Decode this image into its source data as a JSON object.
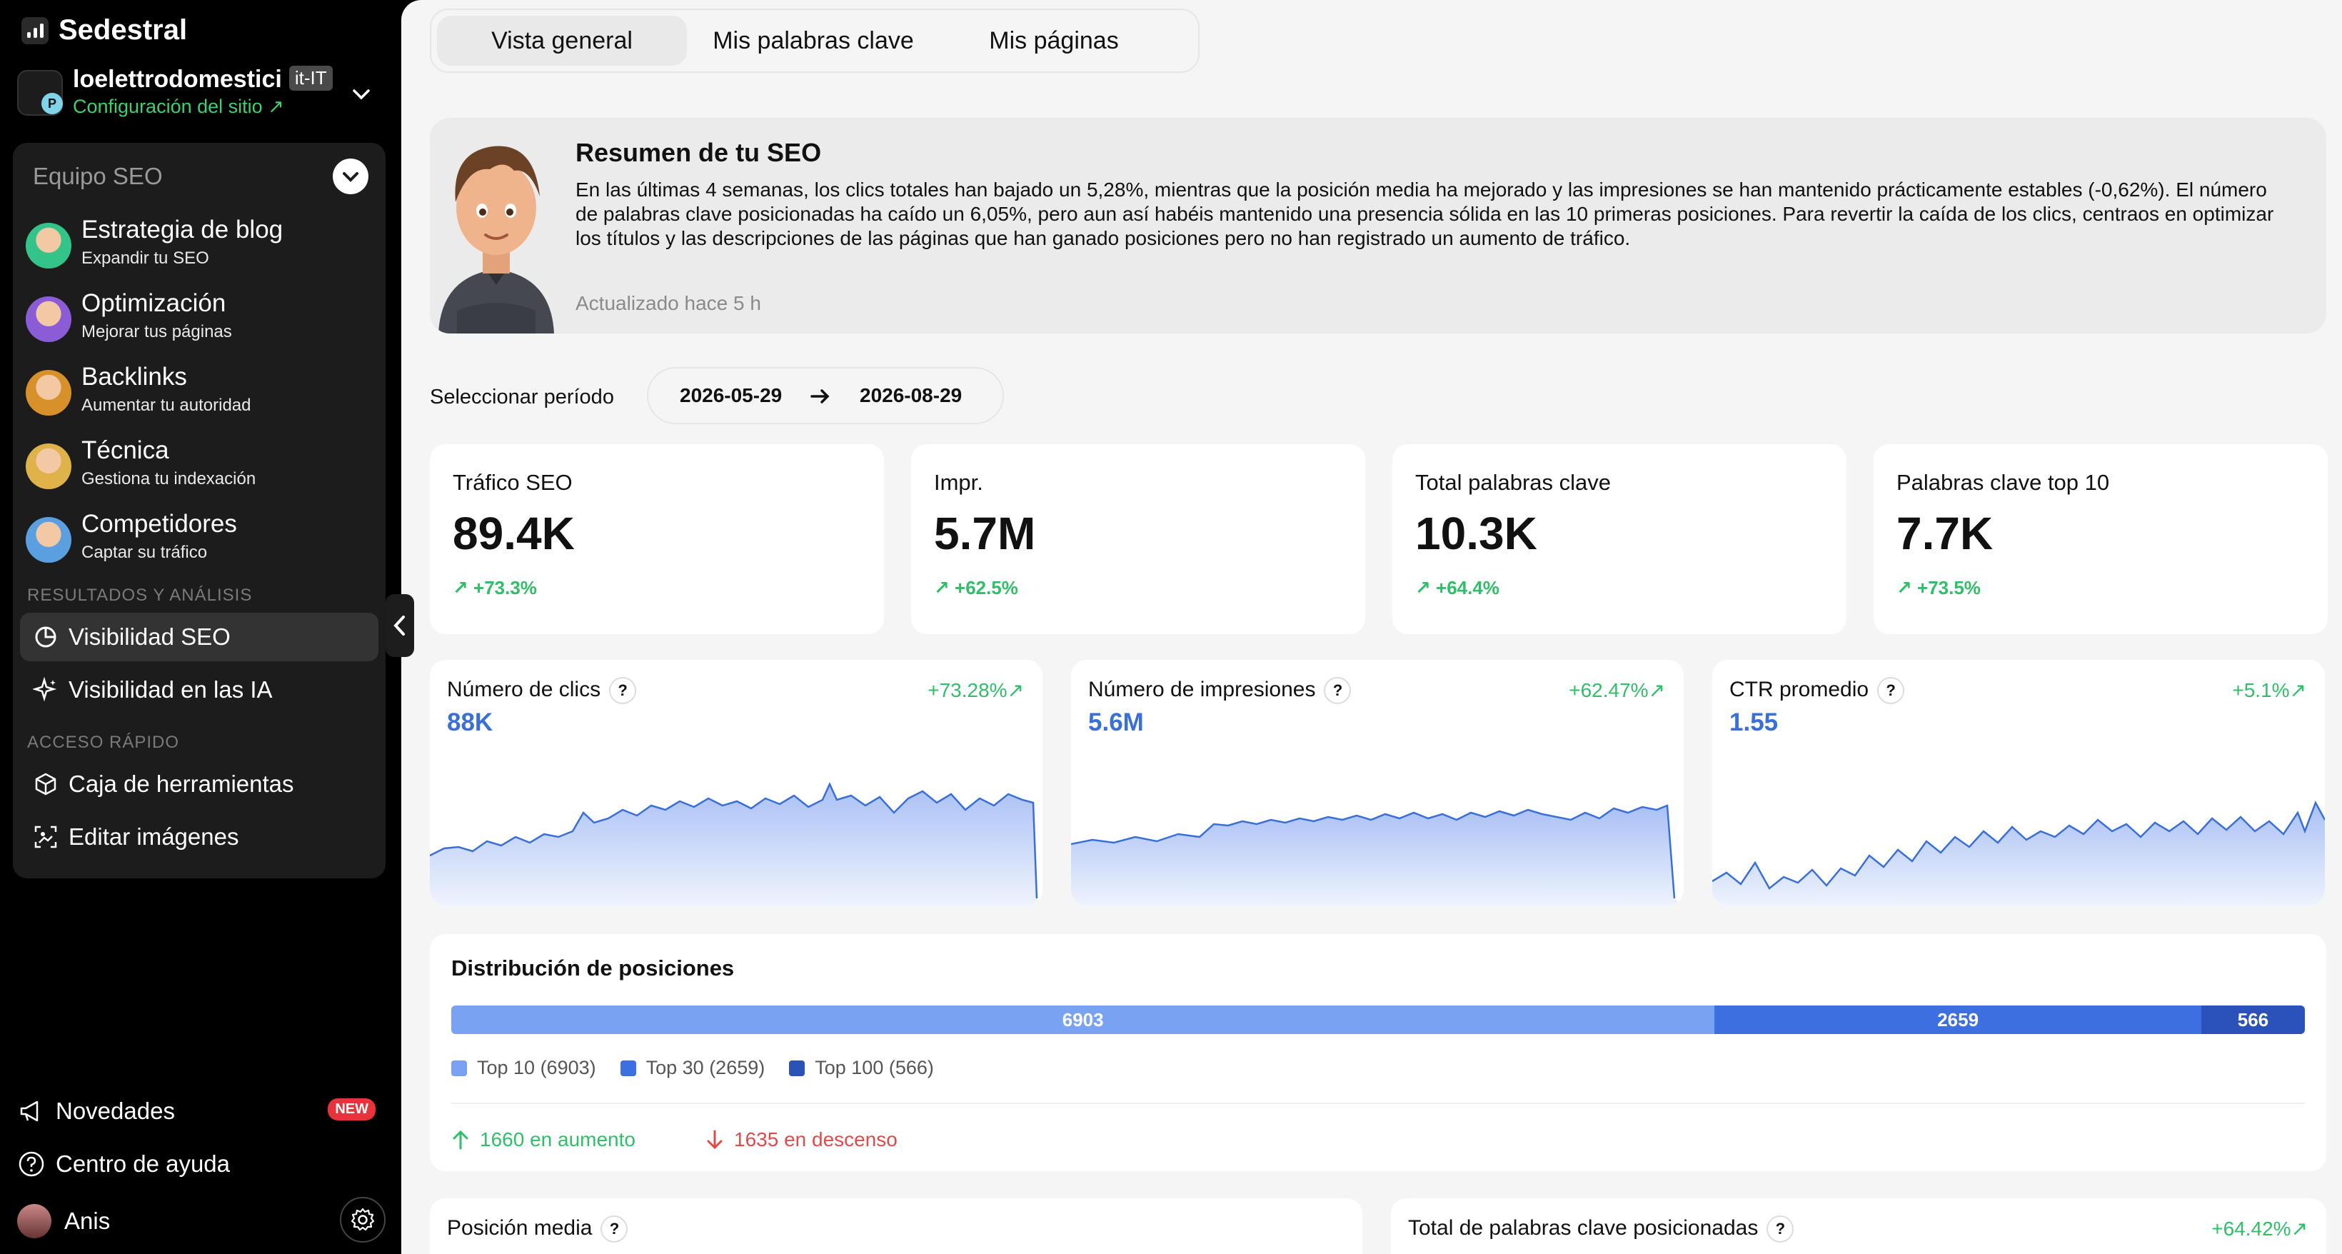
{
  "app": {
    "name": "Sedestral"
  },
  "site": {
    "name": "loelettrodomestici",
    "lang": "it-IT",
    "badge": "P",
    "config_label": "Configuración del sitio ↗"
  },
  "team": {
    "heading": "Equipo SEO",
    "agents": [
      {
        "title": "Estrategia de blog",
        "subtitle": "Expandir tu SEO",
        "color": "#33c48a"
      },
      {
        "title": "Optimización",
        "subtitle": "Mejorar tus páginas",
        "color": "#8a5cd6"
      },
      {
        "title": "Backlinks",
        "subtitle": "Aumentar tu autoridad",
        "color": "#d8902a"
      },
      {
        "title": "Técnica",
        "subtitle": "Gestiona tu indexación",
        "color": "#e0b24a"
      },
      {
        "title": "Competidores",
        "subtitle": "Captar su tráfico",
        "color": "#5aa0e0"
      }
    ],
    "results_heading": "RESULTADOS Y ANÁLISIS",
    "results": [
      {
        "label": "Visibilidad SEO",
        "icon": "pie-chart-icon",
        "active": true
      },
      {
        "label": "Visibilidad en las IA",
        "icon": "sparkle-icon",
        "active": false
      }
    ],
    "quick_heading": "ACCESO RÁPIDO",
    "quick": [
      {
        "label": "Caja de herramientas",
        "icon": "box-icon"
      },
      {
        "label": "Editar imágenes",
        "icon": "image-edit-icon"
      }
    ]
  },
  "bottom": {
    "news_label": "Novedades",
    "news_badge": "NEW",
    "help_label": "Centro de ayuda",
    "user_name": "Anis"
  },
  "tabs": [
    "Vista general",
    "Mis palabras clave",
    "Mis páginas"
  ],
  "summary": {
    "title": "Resumen de tu SEO",
    "text": "En las últimas 4 semanas, los clics totales han bajado un 5,28%, mientras que la posición media ha mejorado y las impresiones se han mantenido prácticamente estables (-0,62%). El número de palabras clave posicionadas ha caído un 6,05%, pero aun así habéis mantenido una presencia sólida en las 10 primeras posiciones. Para revertir la caída de los clics, centraos en optimizar los títulos y las descripciones de las páginas que han ganado posiciones pero no han registrado un aumento de tráfico.",
    "updated": "Actualizado hace 5 h"
  },
  "period": {
    "label": "Seleccionar período",
    "start": "2026-05-29",
    "end": "2026-08-29"
  },
  "kpis": [
    {
      "label": "Tráfico SEO",
      "value": "89.4K",
      "delta": "↗ +73.3%"
    },
    {
      "label": "Impr.",
      "value": "5.7M",
      "delta": "↗ +62.5%"
    },
    {
      "label": "Total palabras clave",
      "value": "10.3K",
      "delta": "↗ +64.4%"
    },
    {
      "label": "Palabras clave top 10",
      "value": "7.7K",
      "delta": "↗ +73.5%"
    }
  ],
  "sparks": [
    {
      "label": "Número de clics",
      "value": "88K",
      "delta": "+73.28%↗"
    },
    {
      "label": "Número de impresiones",
      "value": "5.6M",
      "delta": "+62.47%↗"
    },
    {
      "label": "CTR promedio",
      "value": "1.55",
      "delta": "+5.1%↗"
    }
  ],
  "distribution": {
    "title": "Distribución de posiciones",
    "segments": [
      {
        "label": "Top 10 (6903)",
        "value": 6903,
        "text": "6903",
        "color": "#7aa2f2"
      },
      {
        "label": "Top 30 (2659)",
        "value": 2659,
        "text": "2659",
        "color": "#3d6fe0"
      },
      {
        "label": "Top 100 (566)",
        "value": 566,
        "text": "566",
        "color": "#2b52b8"
      }
    ],
    "up": "1660 en aumento",
    "down": "1635 en descenso"
  },
  "bottom_cards": [
    {
      "label": "Posición media",
      "delta": ""
    },
    {
      "label": "Total de palabras clave posicionadas",
      "delta": "+64.42%↗"
    }
  ]
}
